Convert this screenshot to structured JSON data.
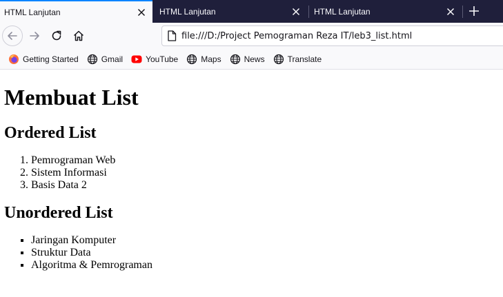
{
  "tabs": [
    {
      "title": "HTML Lanjutan",
      "active": true
    },
    {
      "title": "HTML Lanjutan",
      "active": false
    },
    {
      "title": "HTML Lanjutan",
      "active": false
    }
  ],
  "navbar": {
    "url": "file:///D:/Project Pemograman Reza IT/leb3_list.html"
  },
  "bookmarks": [
    {
      "label": "Getting Started",
      "icon": "firefox-icon"
    },
    {
      "label": "Gmail",
      "icon": "globe-icon"
    },
    {
      "label": "YouTube",
      "icon": "youtube-icon"
    },
    {
      "label": "Maps",
      "icon": "globe-icon"
    },
    {
      "label": "News",
      "icon": "globe-icon"
    },
    {
      "label": "Translate",
      "icon": "globe-icon"
    }
  ],
  "page": {
    "heading": "Membuat List",
    "ordered_heading": "Ordered List",
    "ordered_items": [
      "Pemrograman Web",
      "Sistem Informasi",
      "Basis Data 2"
    ],
    "unordered_heading": "Unordered List",
    "unordered_items": [
      "Jaringan Komputer",
      "Struktur Data",
      "Algoritma & Pemrograman"
    ]
  },
  "colors": {
    "tabstrip_bg": "#1f1f3b",
    "active_tab_accent": "#0a84ff",
    "toolbar_bg": "#f9f9fb"
  }
}
